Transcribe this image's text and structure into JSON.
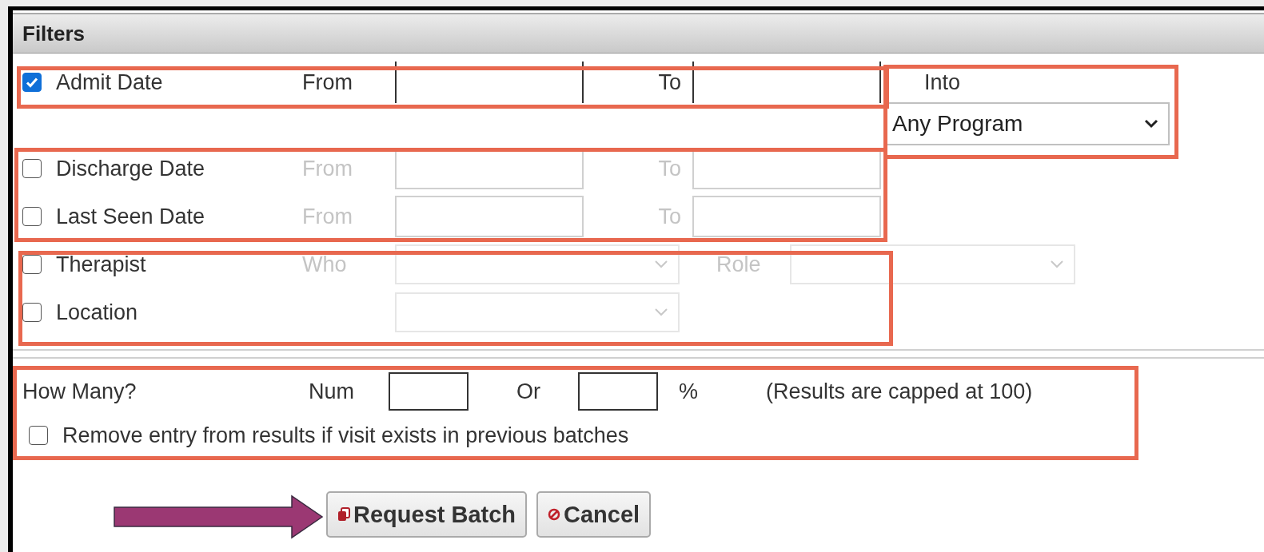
{
  "panel": {
    "title": "Filters"
  },
  "date_filters": [
    {
      "label": "Admit Date",
      "checked": true,
      "from_label": "From",
      "to_label": "To"
    },
    {
      "label": "Discharge Date",
      "checked": false,
      "from_label": "From",
      "to_label": "To"
    },
    {
      "label": "Last Seen Date",
      "checked": false,
      "from_label": "From",
      "to_label": "To"
    }
  ],
  "program": {
    "label": "Into",
    "value": "Any Program"
  },
  "staff_filters": [
    {
      "label": "Therapist",
      "checked": false,
      "who_label": "Who",
      "role_label": "Role"
    },
    {
      "label": "Location",
      "checked": false
    }
  ],
  "how_many": {
    "label": "How Many?",
    "num_label": "Num",
    "or_label": "Or",
    "percent_label": "%",
    "note": "(Results are capped at 100)"
  },
  "remove_duplicates": {
    "label": "Remove entry from results if visit exists in previous batches",
    "checked": false
  },
  "buttons": [
    {
      "label": "Request Batch",
      "kind": "request"
    },
    {
      "label": "Cancel",
      "kind": "cancel"
    }
  ]
}
